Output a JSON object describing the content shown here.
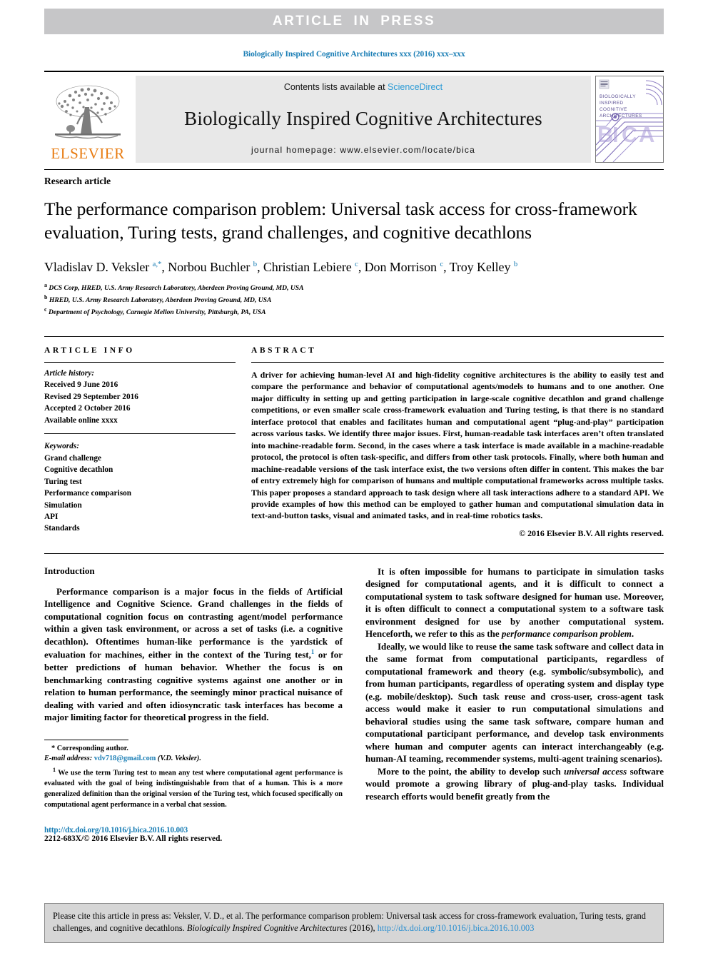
{
  "banner": {
    "text": "ARTICLE  IN  PRESS"
  },
  "running_head": "Biologically Inspired Cognitive Architectures xxx (2016) xxx–xxx",
  "journal_header": {
    "contents_prefix": "Contents lists available at ",
    "sciencedirect": "ScienceDirect",
    "journal_title": "Biologically Inspired Cognitive Architectures",
    "homepage": "journal homepage: www.elsevier.com/locate/bica",
    "publisher": "ELSEVIER",
    "cover_lines": [
      "BIOLOGICALLY",
      "INSPIRED",
      "COGNITIVE",
      "ARCHITECTURES"
    ],
    "cover_logo_text": "BICA"
  },
  "article": {
    "type": "Research article",
    "title": "The performance comparison problem: Universal task access for cross-framework evaluation, Turing tests, grand challenges, and cognitive decathlons",
    "authors_html": "Vladislav D. Veksler <sup>a,*</sup>, Norbou Buchler <sup>b</sup>, Christian Lebiere <sup>c</sup>, Don Morrison <sup>c</sup>, Troy Kelley <sup>b</sup>",
    "affiliations": [
      {
        "mark": "a",
        "text": "DCS Corp, HRED, U.S. Army Research Laboratory, Aberdeen Proving Ground, MD, USA"
      },
      {
        "mark": "b",
        "text": "HRED, U.S. Army Research Laboratory, Aberdeen Proving Ground, MD, USA"
      },
      {
        "mark": "c",
        "text": "Department of Psychology, Carnegie Mellon University, Pittsburgh, PA, USA"
      }
    ]
  },
  "info": {
    "label": "ARTICLE INFO",
    "history_title": "Article history:",
    "history": [
      "Received 9 June 2016",
      "Revised 29 September 2016",
      "Accepted 2 October 2016",
      "Available online xxxx"
    ],
    "keywords_title": "Keywords:",
    "keywords": [
      "Grand challenge",
      "Cognitive decathlon",
      "Turing test",
      "Performance comparison",
      "Simulation",
      "API",
      "Standards"
    ]
  },
  "abstract": {
    "label": "ABSTRACT",
    "text": "A driver for achieving human-level AI and high-fidelity cognitive architectures is the ability to easily test and compare the performance and behavior of computational agents/models to humans and to one another. One major difficulty in setting up and getting participation in large-scale cognitive decathlon and grand challenge competitions, or even smaller scale cross-framework evaluation and Turing testing, is that there is no standard interface protocol that enables and facilitates human and computational agent “plug-and-play” participation across various tasks. We identify three major issues. First, human-readable task interfaces aren’t often translated into machine-readable form. Second, in the cases where a task interface is made available in a machine-readable protocol, the protocol is often task-specific, and differs from other task protocols. Finally, where both human and machine-readable versions of the task interface exist, the two versions often differ in content. This makes the bar of entry extremely high for comparison of humans and multiple computational frameworks across multiple tasks. This paper proposes a standard approach to task design where all task interactions adhere to a standard API. We provide examples of how this method can be employed to gather human and computational simulation data in text-and-button tasks, visual and animated tasks, and in real-time robotics tasks.",
    "copyright": "© 2016 Elsevier B.V. All rights reserved."
  },
  "intro": {
    "heading": "Introduction",
    "left_p1_a": "Performance comparison is a major focus in the fields of Artificial Intelligence and Cognitive Science. Grand challenges in the fields of computational cognition focus on contrasting agent/model performance within a given task environment, or across a set of tasks (i.e. a cognitive decathlon). Oftentimes human-like performance is the yardstick of evaluation for machines, either in the context of the Turing test,",
    "left_p1_sup": "1",
    "left_p1_b": " or for better predictions of human behavior. Whether the focus is on benchmarking contrasting cognitive systems against one another or in relation to human performance, the seemingly minor practical nuisance of dealing with varied and often idiosyncratic task interfaces has become a major limiting factor for theoretical progress in the field.",
    "right_p1_a": "It is often impossible for humans to participate in simulation tasks designed for computational agents, and it is difficult to connect a computational system to task software designed for human use. Moreover, it is often difficult to connect a computational system to a software task environment designed for use by another computational system. Henceforth, we refer to this as the ",
    "right_p1_em": "performance comparison problem",
    "right_p1_b": ".",
    "right_p2": "Ideally, we would like to reuse the same task software and collect data in the same format from computational participants, regardless of computational framework and theory (e.g. symbolic/subsymbolic), and from human participants, regardless of operating system and display type (e.g. mobile/desktop). Such task reuse and cross-user, cross-agent task access would make it easier to run computational simulations and behavioral studies using the same task software, compare human and computational participant performance, and develop task environments where human and computer agents can interact interchangeably (e.g. human-AI teaming, recommender systems, multi-agent training scenarios).",
    "right_p3_a": "More to the point, the ability to develop such ",
    "right_p3_em": "universal access",
    "right_p3_b": " software would promote a growing library of plug-and-play tasks. Individual research efforts would benefit greatly from the"
  },
  "footnotes": {
    "corresponding": "Corresponding author.",
    "email_label": "E-mail address:",
    "email": "vdv718@gmail.com",
    "email_suffix": "(V.D. Veksler).",
    "note1_marker": "1",
    "note1": "We use the term Turing test to mean any test where computational agent performance is evaluated with the goal of being indistinguishable from that of a human. This is a more generalized definition than the original version of the Turing test, which focused specifically on computational agent performance in a verbal chat session."
  },
  "publication": {
    "doi": "http://dx.doi.org/10.1016/j.bica.2016.10.003",
    "issn_line": "2212-683X/© 2016 Elsevier B.V. All rights reserved."
  },
  "citation_box": {
    "prefix": "Please cite this article in press as: Veksler, V. D., et al. The performance comparison problem: Universal task access for cross-framework evaluation, Turing tests, grand challenges, and cognitive decathlons. ",
    "journal": "Biologically Inspired Cognitive Architectures",
    "year": " (2016), ",
    "link": "http://dx.doi.org/10.1016/j.bica.2016.10.003"
  },
  "colors": {
    "banner_bg": "#c6c6c8",
    "link_blue": "#1a7eb5",
    "elsevier_orange": "#e87b10",
    "header_gray": "#e8e8e8",
    "cite_gray": "#d6d6d6"
  }
}
